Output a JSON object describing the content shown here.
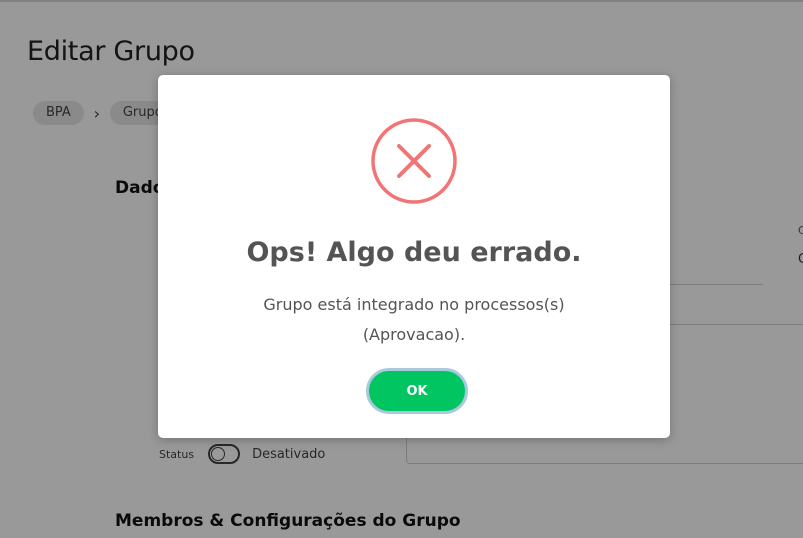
{
  "page": {
    "title": "Editar Grupo",
    "breadcrumb": [
      "BPA",
      "Grupos"
    ],
    "sections": {
      "dados": "Dados",
      "membros": "Membros & Configurações do Grupo"
    },
    "right_field": {
      "label": "C",
      "value": "C"
    },
    "status": {
      "label": "Status",
      "value": "Desativado",
      "enabled": false
    }
  },
  "modal": {
    "icon": "error-x-icon",
    "title": "Ops! Algo deu errado.",
    "message": "Grupo está integrado no processos(s) (Aprovacao).",
    "ok_label": "OK"
  },
  "colors": {
    "error_red": "#f27474",
    "ok_green": "#00c561",
    "ok_border": "#a8c9de",
    "overlay": "rgba(0,0,0,0.4)"
  }
}
